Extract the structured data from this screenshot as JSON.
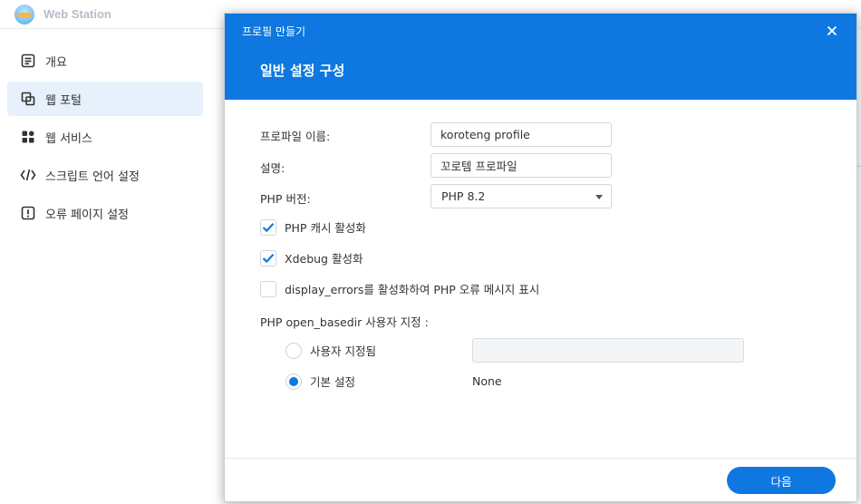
{
  "app": {
    "title": "Web Station"
  },
  "sidebar": {
    "items": [
      {
        "label": "개요",
        "icon": "overview-icon",
        "active": false
      },
      {
        "label": "웹 포털",
        "icon": "web-portal-icon",
        "active": true
      },
      {
        "label": "웹 서비스",
        "icon": "web-service-icon",
        "active": false
      },
      {
        "label": "스크립트 언어 설정",
        "icon": "code-icon",
        "active": false
      },
      {
        "label": "오류 페이지 설정",
        "icon": "error-page-icon",
        "active": false
      }
    ]
  },
  "dialog": {
    "title": "프로필 만들기",
    "step_title": "일반 설정 구성",
    "fields": {
      "profile_name_label": "프로파일 이름:",
      "profile_name_value": "koroteng profile",
      "description_label": "설명:",
      "description_value": "꼬로템 프로파일",
      "php_version_label": "PHP 버전:",
      "php_version_value": "PHP 8.2"
    },
    "checkboxes": {
      "php_cache": {
        "label": "PHP 캐시 활성화",
        "checked": true
      },
      "xdebug": {
        "label": "Xdebug 활성화",
        "checked": true
      },
      "display_errors": {
        "label": "display_errors를 활성화하여 PHP 오류 메시지 표시",
        "checked": false
      }
    },
    "open_basedir": {
      "label": "PHP open_basedir 사용자 지정 :",
      "custom_label": "사용자 지정됨",
      "custom_value": "",
      "default_label": "기본 설정",
      "default_value": "None",
      "selected": "default"
    },
    "next_label": "다음"
  },
  "colors": {
    "accent": "#0e78e0",
    "sidebar_active": "#e6f1fb",
    "check": "#0e78e0"
  }
}
